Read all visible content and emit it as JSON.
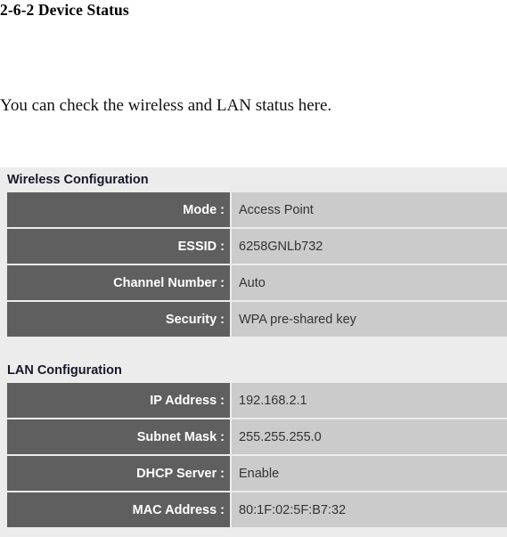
{
  "document": {
    "title": "2-6-2 Device Status",
    "paragraph": "You can check the wireless and LAN status here."
  },
  "colors": {
    "panel_background": "#ececec",
    "label_cell": "#5f5f5f",
    "label_text": "#ffffff",
    "value_cell": "#cbcbcb",
    "value_text": "#333333",
    "heading_text": "#18182c"
  },
  "panel": {
    "sections": [
      {
        "heading": "Wireless Configuration",
        "rows": [
          {
            "label": "Mode :",
            "value": "Access Point"
          },
          {
            "label": "ESSID :",
            "value": "6258GNLb732"
          },
          {
            "label": "Channel Number :",
            "value": "Auto"
          },
          {
            "label": "Security :",
            "value": "WPA pre-shared key"
          }
        ]
      },
      {
        "heading": "LAN Configuration",
        "rows": [
          {
            "label": "IP Address :",
            "value": "192.168.2.1"
          },
          {
            "label": "Subnet Mask :",
            "value": "255.255.255.0"
          },
          {
            "label": "DHCP Server :",
            "value": "Enable"
          },
          {
            "label": "MAC Address :",
            "value": "80:1F:02:5F:B7:32"
          }
        ]
      }
    ]
  }
}
